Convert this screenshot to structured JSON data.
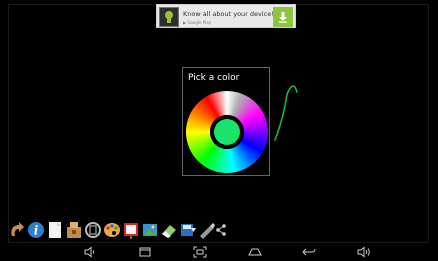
{
  "ad": {
    "text": "Know all about your device!",
    "sub": "▶ Google Play"
  },
  "picker": {
    "title": "Pick a color",
    "selected_color": "#19e36a"
  },
  "stroke_color": "#21b33c",
  "toolbar": {
    "icons": [
      "undo-icon",
      "info-icon",
      "page-icon",
      "stamp-icon",
      "recycle-icon",
      "palette-icon",
      "canvas-icon",
      "gallery-icon",
      "eraser-icon",
      "save-icon",
      "brush-icon",
      "share-icon"
    ]
  },
  "navbar": {
    "icons": [
      "volume-down-icon",
      "recent-apps-icon",
      "screenshot-icon",
      "home-icon",
      "back-icon",
      "volume-up-icon"
    ]
  }
}
